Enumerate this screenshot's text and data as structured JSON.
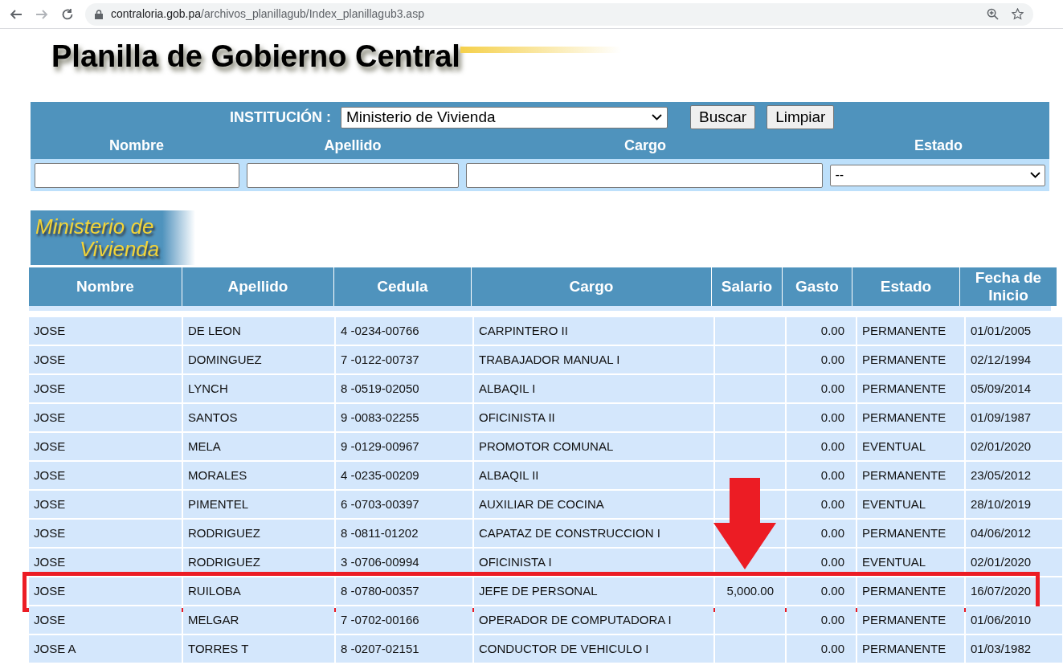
{
  "browser": {
    "url_host": "contraloria.gob.pa",
    "url_path": "/archivos_planillagub/Index_planillagub3.asp"
  },
  "page_title": "Planilla de Gobierno Central",
  "filter": {
    "institution_label": "INSTITUCIÓN :",
    "institution_value": "Ministerio de Vivienda",
    "buttons": [
      "Buscar",
      "Limpiar"
    ],
    "field_labels": [
      "Nombre",
      "Apellido",
      "Cargo",
      "Estado"
    ],
    "estado_value": "--"
  },
  "institution_banner": [
    "Ministerio de",
    "Vivienda"
  ],
  "table": {
    "columns": [
      "Nombre",
      "Apellido",
      "Cedula",
      "Cargo",
      "Salario",
      "Gasto",
      "Estado",
      "Fecha de Inicio"
    ],
    "rows": [
      {
        "cells": [
          "JOSE",
          "DE LEON",
          "4 -0234-00766",
          "CARPINTERO II",
          "",
          "0.00",
          "PERMANENTE",
          "01/01/2005"
        ],
        "highlighted": false
      },
      {
        "cells": [
          "JOSE",
          "DOMINGUEZ",
          "7 -0122-00737",
          "TRABAJADOR MANUAL I",
          "",
          "0.00",
          "PERMANENTE",
          "02/12/1994"
        ],
        "highlighted": false
      },
      {
        "cells": [
          "JOSE",
          "LYNCH",
          "8 -0519-02050",
          "ALBAQIL I",
          "",
          "0.00",
          "PERMANENTE",
          "05/09/2014"
        ],
        "highlighted": false
      },
      {
        "cells": [
          "JOSE",
          "SANTOS",
          "9 -0083-02255",
          "OFICINISTA II",
          "",
          "0.00",
          "PERMANENTE",
          "01/09/1987"
        ],
        "highlighted": false
      },
      {
        "cells": [
          "JOSE",
          "MELA",
          "9 -0129-00967",
          "PROMOTOR COMUNAL",
          "",
          "0.00",
          "EVENTUAL",
          "02/01/2020"
        ],
        "highlighted": false
      },
      {
        "cells": [
          "JOSE",
          "MORALES",
          "4 -0235-00209",
          "ALBAQIL II",
          "",
          "0.00",
          "PERMANENTE",
          "23/05/2012"
        ],
        "highlighted": false
      },
      {
        "cells": [
          "JOSE",
          "PIMENTEL",
          "6 -0703-00397",
          "AUXILIAR DE COCINA",
          "",
          "0.00",
          "EVENTUAL",
          "28/10/2019"
        ],
        "highlighted": false
      },
      {
        "cells": [
          "JOSE",
          "RODRIGUEZ",
          "8 -0811-01202",
          "CAPATAZ DE CONSTRUCCION I",
          "",
          "0.00",
          "PERMANENTE",
          "04/06/2012"
        ],
        "highlighted": false
      },
      {
        "cells": [
          "JOSE",
          "RODRIGUEZ",
          "3 -0706-00994",
          "OFICINISTA I",
          "",
          "0.00",
          "EVENTUAL",
          "02/01/2020"
        ],
        "highlighted": false
      },
      {
        "cells": [
          "JOSE",
          "RUILOBA",
          "8 -0780-00357",
          "JEFE DE PERSONAL",
          "5,000.00",
          "0.00",
          "PERMANENTE",
          "16/07/2020"
        ],
        "highlighted": true
      },
      {
        "cells": [
          "JOSE",
          "MELGAR",
          "7 -0702-00166",
          "OPERADOR DE COMPUTADORA I",
          "",
          "0.00",
          "PERMANENTE",
          "01/06/2010"
        ],
        "highlighted": false
      },
      {
        "cells": [
          "JOSE A",
          "TORRES T",
          "8 -0207-02151",
          "CONDUCTOR DE VEHICULO I",
          "",
          "0.00",
          "PERMANENTE",
          "01/03/1982"
        ],
        "highlighted": false
      }
    ]
  }
}
